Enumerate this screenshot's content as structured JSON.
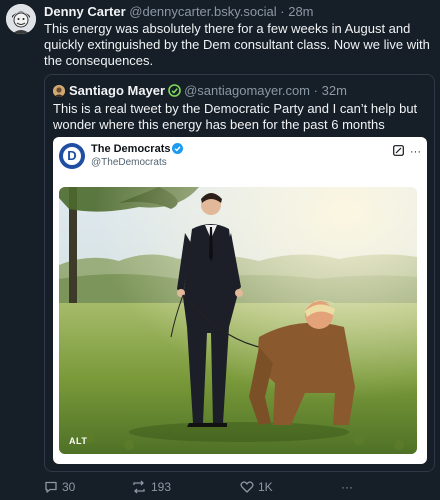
{
  "post": {
    "author_name": "Denny Carter",
    "author_handle": "@dennycarter.bsky.social",
    "separator": "·",
    "time": "28m",
    "text": "This energy was absolutely there for a few weeks in August and quickly extinguished by the Dem consultant class. Now we live with the consequences."
  },
  "quote": {
    "author_name": "Santiago Mayer",
    "author_handle": "@santiagomayer.com",
    "separator": "·",
    "time": "32m",
    "text": "This is a real tweet by the Democratic Party and I can’t help but wonder where this energy has been for the past 6 months",
    "embed": {
      "name": "The Democrats",
      "handle": "@TheDemocrats",
      "logo_letter": "D",
      "more_label": "···",
      "alt_badge": "ALT"
    }
  },
  "actions": {
    "replies": "30",
    "reposts": "193",
    "likes": "1K",
    "more": "···"
  },
  "colors": {
    "background": "#161e27",
    "border": "#2e3a47",
    "muted_text": "#8b98a5",
    "verified": "#1d9bf0",
    "dem_blue": "#1f4ea3"
  }
}
